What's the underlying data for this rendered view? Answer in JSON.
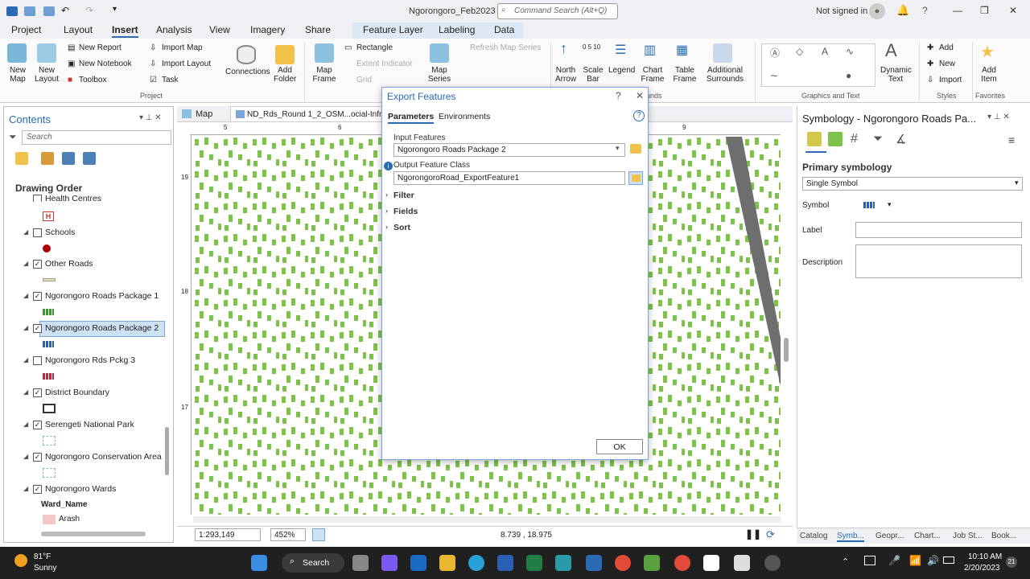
{
  "titlebar": {
    "title": "Ngorongoro_Feb2023",
    "search_placeholder": "Command Search (Alt+Q)",
    "signin": "Not signed in"
  },
  "tabs": [
    "Project",
    "Layout",
    "Insert",
    "Analysis",
    "View",
    "Imagery",
    "Share",
    "Feature Layer",
    "Labeling",
    "Data"
  ],
  "active_tab": "Insert",
  "ribbon": {
    "new_map": "New Map",
    "new_layout": "New Layout",
    "new_report": "New Report",
    "new_notebook": "New Notebook",
    "toolbox": "Toolbox",
    "import_map": "Import Map",
    "import_layout": "Import Layout",
    "task": "Task",
    "connections": "Connections",
    "add_folder": "Add Folder",
    "map_frame": "Map Frame",
    "rectangle": "Rectangle",
    "extent_indicator": "Extent Indicator",
    "grid": "Grid",
    "map_series": "Map Series",
    "refresh_map_series": "Refresh Map Series",
    "north_arrow": "North Arrow",
    "scale_bar": "Scale Bar",
    "legend": "Legend",
    "chart_frame": "Chart Frame",
    "table_frame": "Table Frame",
    "additional_surrounds": "Additional Surrounds",
    "dynamic_text": "Dynamic Text",
    "add": "Add",
    "new": "New",
    "import": "Import",
    "add_item": "Add Item",
    "groups": {
      "project": "Project",
      "surrounds": "rrounds",
      "graphics_text": "Graphics and Text",
      "styles": "Styles",
      "favorites": "Favorites"
    }
  },
  "contents": {
    "title": "Contents",
    "search_placeholder": "Search",
    "drawing_order": "Drawing Order",
    "layers": [
      {
        "name": "Health Centres",
        "checked": false
      },
      {
        "name": "Schools",
        "checked": false
      },
      {
        "name": "Other Roads",
        "checked": true
      },
      {
        "name": "Ngorongoro Roads Package 1",
        "checked": true
      },
      {
        "name": "Ngorongoro  Roads Package 2",
        "checked": true
      },
      {
        "name": "Ngorongoro Rds Pckg 3",
        "checked": false
      },
      {
        "name": "District Boundary",
        "checked": true
      },
      {
        "name": "Serengeti National Park",
        "checked": true
      },
      {
        "name": "Ngorongoro Conservation Area",
        "checked": true
      },
      {
        "name": "Ngorongoro Wards",
        "checked": true
      }
    ],
    "ward_field": "Ward_Name",
    "ward_value": "Arash"
  },
  "map": {
    "tab1": "Map",
    "tab2": "ND_Rds_Round 1_2_OSM...ocial-Infras",
    "ruler_top": [
      "5",
      "6",
      "9"
    ],
    "ruler_left": [
      "19",
      "18",
      "17"
    ],
    "scale": "1:293,149",
    "zoom": "452%",
    "coords": "8.739 , 18.975"
  },
  "dialog": {
    "title": "Export Features",
    "tab_params": "Parameters",
    "tab_env": "Environments",
    "input_label": "Input Features",
    "input_value": "Ngorongoro  Roads Package  2",
    "output_label": "Output Feature Class",
    "output_value": "NgorongoroRoad_ExportFeature1",
    "sections": [
      "Filter",
      "Fields",
      "Sort"
    ],
    "ok": "OK"
  },
  "symbology": {
    "title": "Symbology - Ngorongoro  Roads Pa...",
    "primary": "Primary symbology",
    "type": "Single Symbol",
    "symbol_label": "Symbol",
    "label_label": "Label",
    "description_label": "Description"
  },
  "bottom_tabs": [
    "Catalog",
    "Symb...",
    "Geopr...",
    "Chart...",
    "Job St...",
    "Book..."
  ],
  "taskbar": {
    "temp": "81°F",
    "weather": "Sunny",
    "search": "Search",
    "time": "10:10 AM",
    "date": "2/20/2023",
    "badge": "21"
  },
  "colors": {
    "accent": "#2a6bb3",
    "road_green": "#7dc24b",
    "road_gray": "#6e6e6e"
  }
}
